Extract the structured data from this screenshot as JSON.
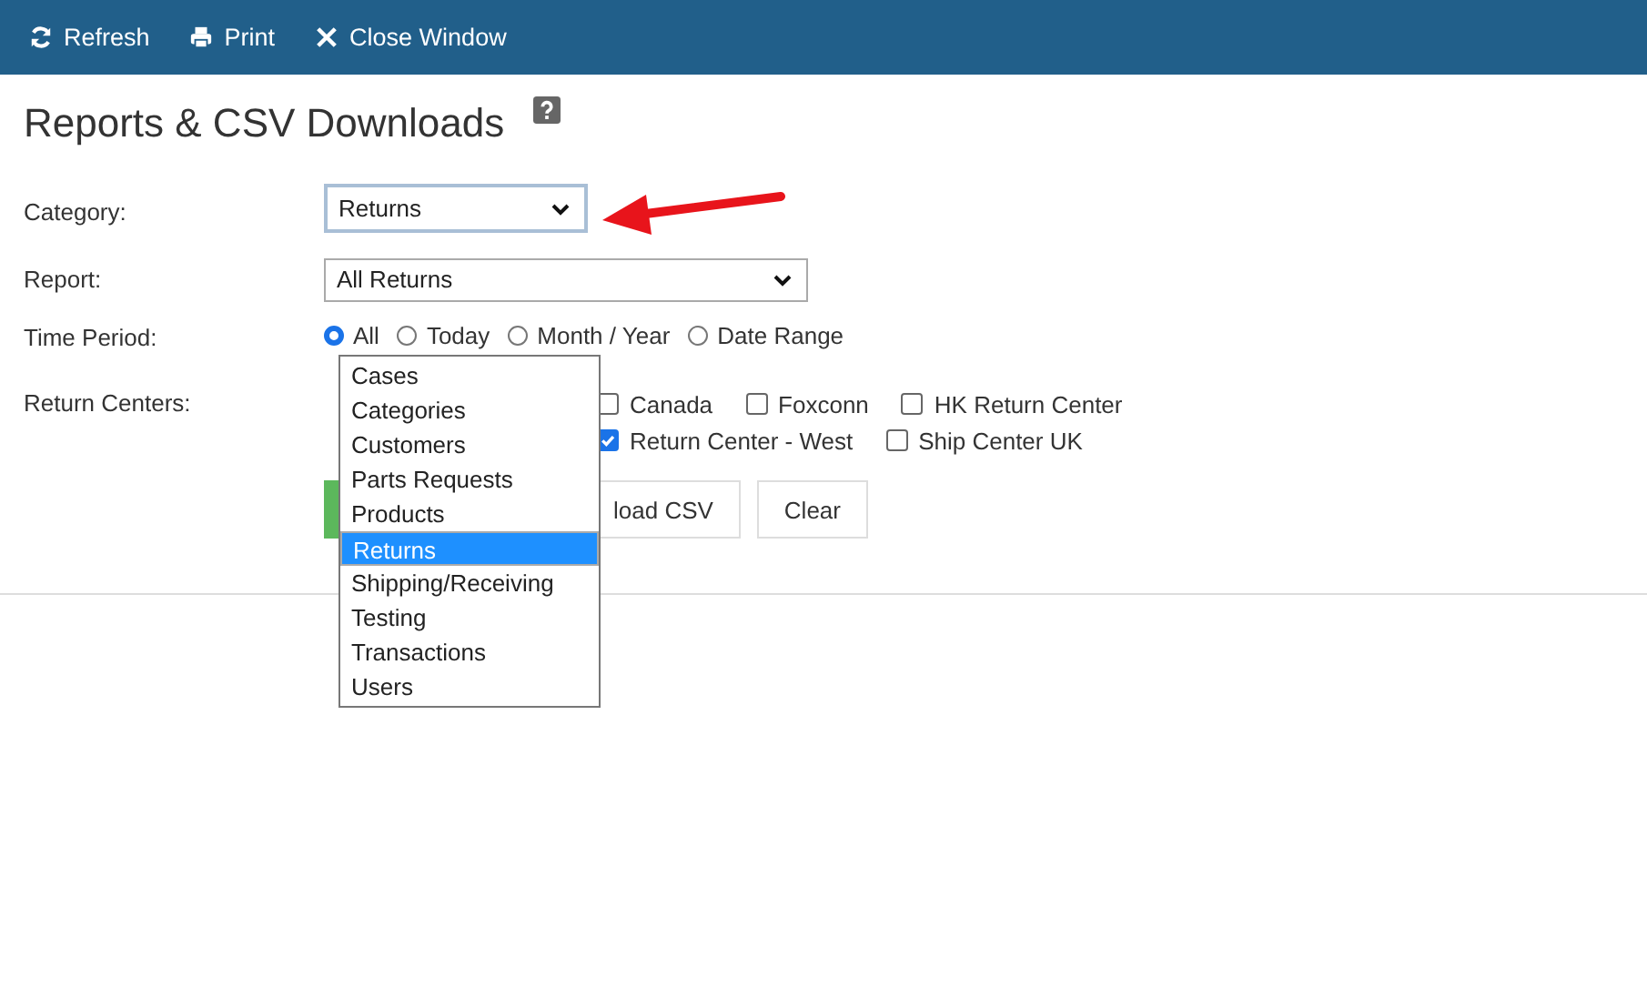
{
  "toolbar": [
    {
      "kind": "refresh",
      "label": "Refresh"
    },
    {
      "kind": "print",
      "label": "Print"
    },
    {
      "kind": "close",
      "label": "Close Window"
    }
  ],
  "title": "Reports & CSV Downloads",
  "category": {
    "label": "Category:",
    "value": "Returns"
  },
  "report": {
    "label": "Report:",
    "value": "All Returns"
  },
  "time_period": {
    "label": "Time Period:",
    "options": [
      {
        "label": "All",
        "selected": true
      },
      {
        "label": "Today",
        "selected": false
      },
      {
        "label": "Month / Year",
        "selected": false
      },
      {
        "label": "Date Range",
        "selected": false
      }
    ]
  },
  "return_centers": {
    "label": "Return Centers:",
    "options": [
      {
        "label": "Canada",
        "checked": false
      },
      {
        "label": "Foxconn",
        "checked": false
      },
      {
        "label": "HK Return Center",
        "checked": false
      },
      {
        "label": "Return Center - West",
        "checked": true
      },
      {
        "label": "Ship Center UK",
        "checked": false
      }
    ]
  },
  "buttons": [
    {
      "kind": "primary"
    },
    {
      "kind": "default",
      "label": "load CSV"
    },
    {
      "kind": "default",
      "label": "Clear"
    }
  ],
  "category_dropdown": [
    {
      "label": "Cases",
      "selected": false
    },
    {
      "label": "Categories",
      "selected": false
    },
    {
      "label": "Customers",
      "selected": false
    },
    {
      "label": "Parts Requests",
      "selected": false
    },
    {
      "label": "Products",
      "selected": false
    },
    {
      "label": "Returns",
      "selected": true
    },
    {
      "label": "Shipping/Receiving",
      "selected": false
    },
    {
      "label": "Testing",
      "selected": false
    },
    {
      "label": "Transactions",
      "selected": false
    },
    {
      "label": "Users",
      "selected": false
    }
  ]
}
